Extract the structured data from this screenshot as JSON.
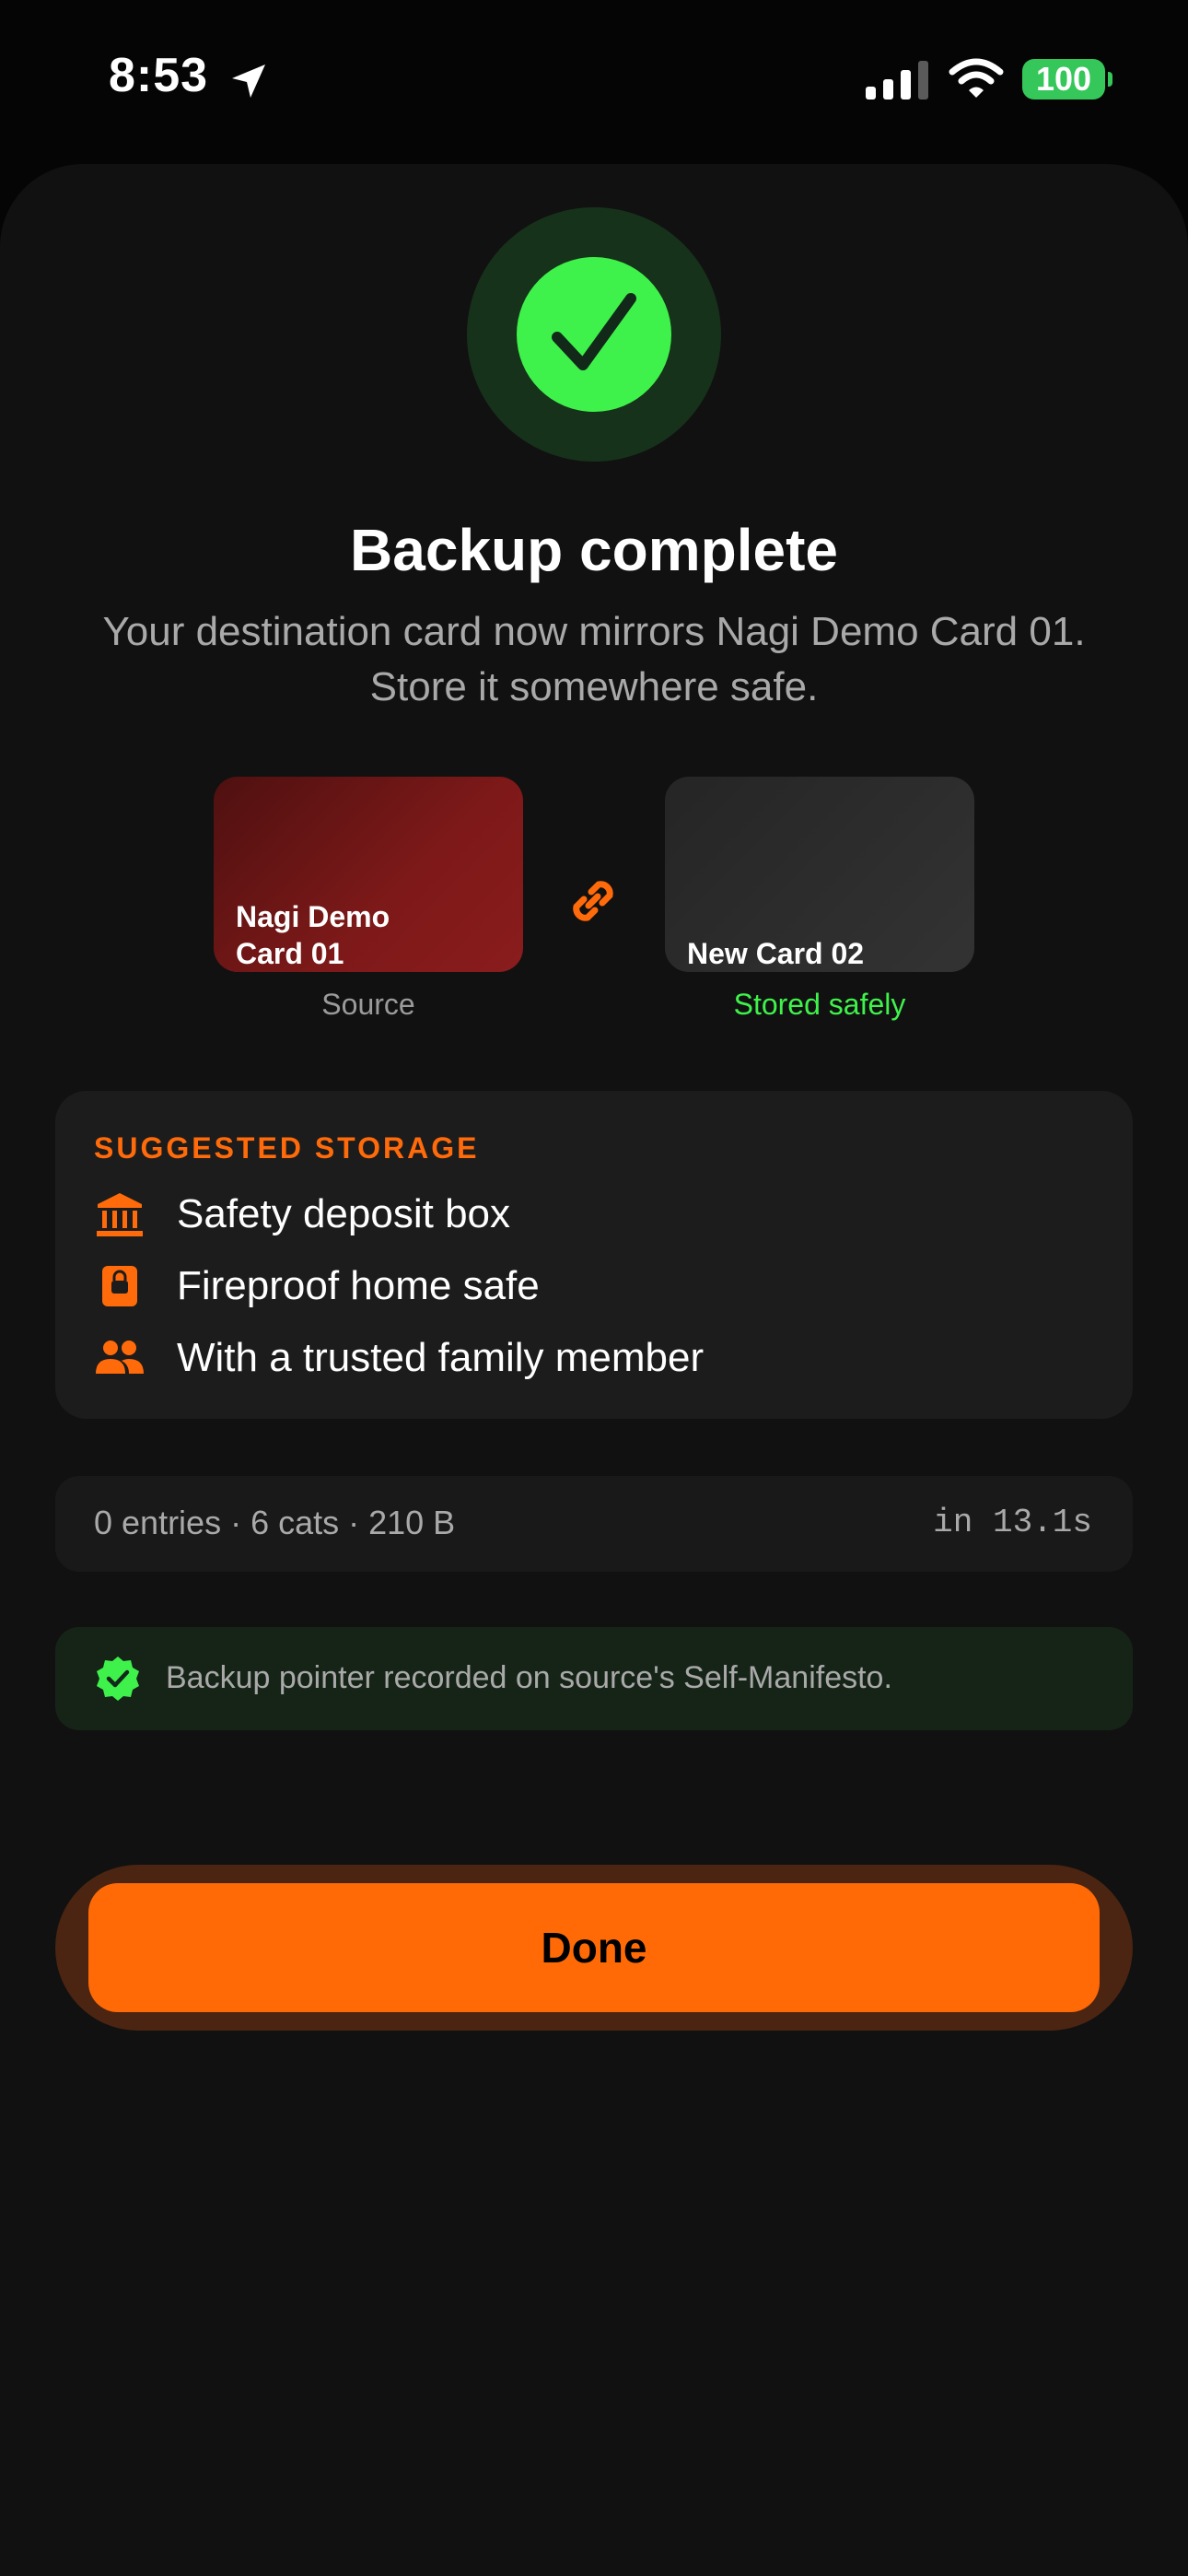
{
  "status_bar": {
    "time": "8:53",
    "battery": "100",
    "icons": [
      "location-arrow-icon",
      "cellular-signal-icon",
      "wifi-icon",
      "battery-icon"
    ]
  },
  "header": {
    "title": "Backup complete",
    "subtitle": "Your destination card now mirrors Nagi Demo Card 01. Store it somewhere safe."
  },
  "cards": {
    "source": {
      "name": "Nagi Demo Card 01",
      "caption": "Source"
    },
    "destination": {
      "name": "New Card 02",
      "caption": "Stored safely"
    },
    "link_icon": "link-icon"
  },
  "storage": {
    "heading": "SUGGESTED STORAGE",
    "items": [
      {
        "icon": "bank-icon",
        "label": "Safety deposit box"
      },
      {
        "icon": "lock-icon",
        "label": "Fireproof home safe"
      },
      {
        "icon": "people-icon",
        "label": "With a trusted family member"
      }
    ]
  },
  "stats": {
    "summary": "0 entries · 6 cats · 210 B",
    "duration": "in 13.1s"
  },
  "notice": {
    "icon": "verified-badge-icon",
    "text": "Backup pointer recorded on source's Self-Manifesto."
  },
  "actions": {
    "done_label": "Done"
  },
  "colors": {
    "accent": "#ff6a06",
    "success": "#3ff24b",
    "background": "#111111"
  }
}
